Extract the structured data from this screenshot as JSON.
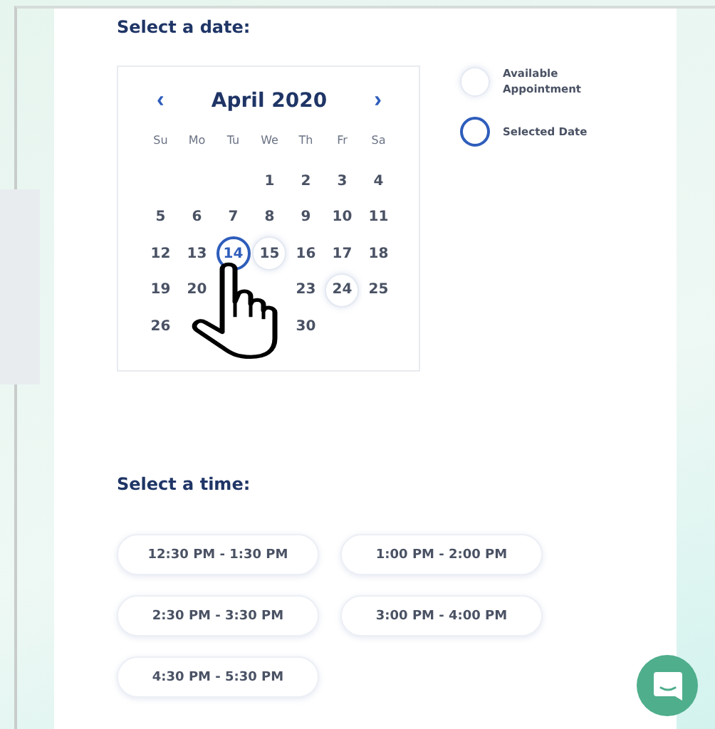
{
  "date_section": {
    "title": "Select a date:"
  },
  "calendar": {
    "prev": "‹",
    "month": "April 2020",
    "next": "›",
    "weekdays": [
      "Su",
      "Mo",
      "Tu",
      "We",
      "Th",
      "Fr",
      "Sa"
    ],
    "days": [
      {
        "kind": "blank"
      },
      {
        "kind": "blank"
      },
      {
        "kind": "blank"
      },
      {
        "kind": "day",
        "label": "1",
        "available": false,
        "selected": false
      },
      {
        "kind": "day",
        "label": "2",
        "available": false,
        "selected": false
      },
      {
        "kind": "day",
        "label": "3",
        "available": false,
        "selected": false
      },
      {
        "kind": "day",
        "label": "4",
        "available": false,
        "selected": false
      },
      {
        "kind": "day",
        "label": "5",
        "available": false,
        "selected": false
      },
      {
        "kind": "day",
        "label": "6",
        "available": false,
        "selected": false
      },
      {
        "kind": "day",
        "label": "7",
        "available": false,
        "selected": false
      },
      {
        "kind": "day",
        "label": "8",
        "available": false,
        "selected": false
      },
      {
        "kind": "day",
        "label": "9",
        "available": false,
        "selected": false
      },
      {
        "kind": "day",
        "label": "10",
        "available": false,
        "selected": false
      },
      {
        "kind": "day",
        "label": "11",
        "available": false,
        "selected": false
      },
      {
        "kind": "day",
        "label": "12",
        "available": false,
        "selected": false
      },
      {
        "kind": "day",
        "label": "13",
        "available": false,
        "selected": false
      },
      {
        "kind": "day",
        "label": "14",
        "available": true,
        "selected": true
      },
      {
        "kind": "day",
        "label": "15",
        "available": true,
        "selected": false
      },
      {
        "kind": "day",
        "label": "16",
        "available": false,
        "selected": false
      },
      {
        "kind": "day",
        "label": "17",
        "available": false,
        "selected": false
      },
      {
        "kind": "day",
        "label": "18",
        "available": false,
        "selected": false
      },
      {
        "kind": "day",
        "label": "19",
        "available": false,
        "selected": false
      },
      {
        "kind": "day",
        "label": "20",
        "available": false,
        "selected": false
      },
      {
        "kind": "blank"
      },
      {
        "kind": "blank"
      },
      {
        "kind": "day",
        "label": "23",
        "available": false,
        "selected": false
      },
      {
        "kind": "day",
        "label": "24",
        "available": true,
        "selected": false
      },
      {
        "kind": "day",
        "label": "25",
        "available": false,
        "selected": false
      },
      {
        "kind": "day",
        "label": "26",
        "available": false,
        "selected": false
      },
      {
        "kind": "blank"
      },
      {
        "kind": "blank"
      },
      {
        "kind": "blank"
      },
      {
        "kind": "day",
        "label": "30",
        "available": false,
        "selected": false
      }
    ]
  },
  "legend": [
    {
      "kind": "available",
      "label": "Available Appointment"
    },
    {
      "kind": "selected",
      "label": "Selected Date"
    }
  ],
  "time_section": {
    "title": "Select a time:"
  },
  "times": [
    {
      "label": "12:30 PM - 1:30 PM",
      "selected": false
    },
    {
      "label": "1:00 PM - 2:00 PM",
      "selected": false
    },
    {
      "label": "2:30 PM - 3:30 PM",
      "selected": false
    },
    {
      "label": "3:00 PM - 4:00 PM",
      "selected": false
    },
    {
      "label": "4:30 PM - 5:30 PM",
      "selected": false
    }
  ]
}
